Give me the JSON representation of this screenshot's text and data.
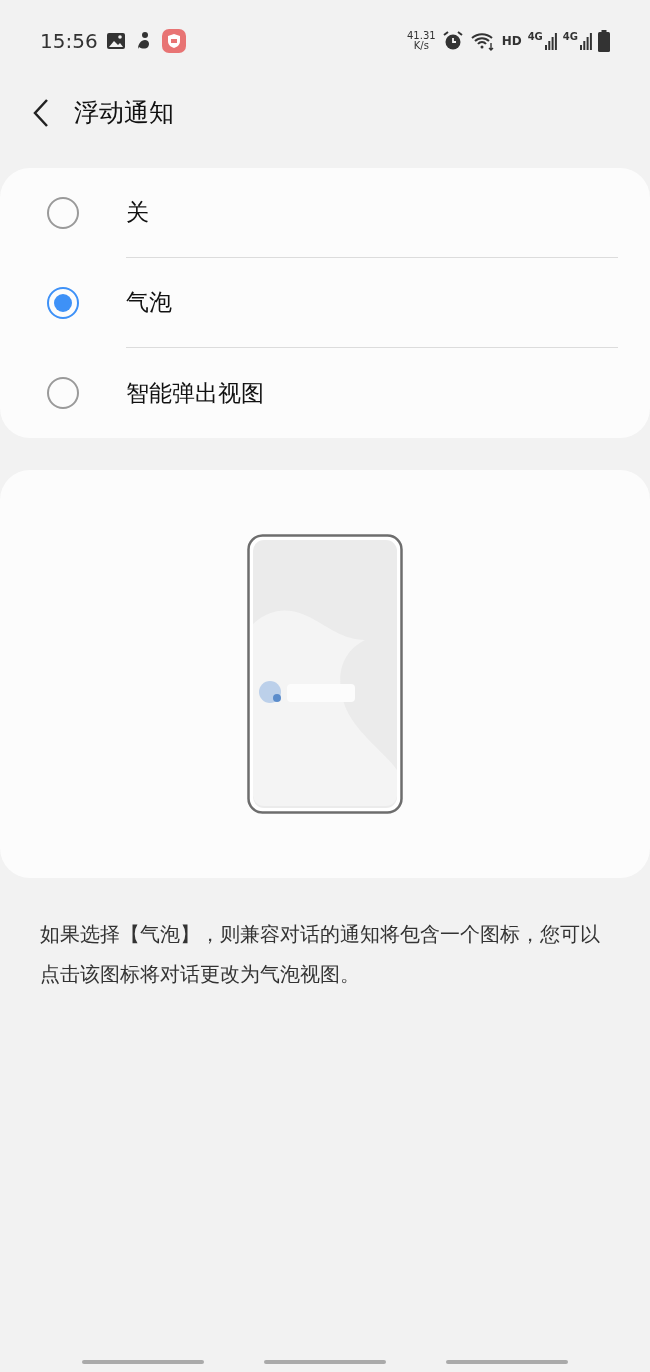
{
  "status_bar": {
    "time": "15:56",
    "speed": [
      "41.31",
      "K/s"
    ],
    "hd": "HD",
    "networks": [
      "4G",
      "4G"
    ]
  },
  "header": {
    "title": "浮动通知"
  },
  "options": [
    {
      "label": "关",
      "selected": false
    },
    {
      "label": "气泡",
      "selected": true
    },
    {
      "label": "智能弹出视图",
      "selected": false
    }
  ],
  "illustration": {
    "kind": "bubble-preview"
  },
  "description": "如果选择【气泡】，则兼容对话的通知将包含一个图标，您可以点击该图标将对话更改为气泡视图。"
}
